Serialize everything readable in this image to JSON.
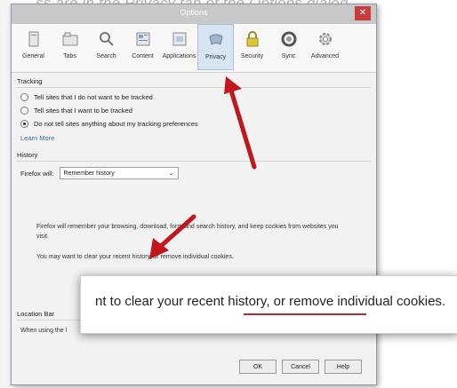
{
  "background": {
    "caption": "ss are in the Privacy tab of the Options dialog"
  },
  "dialog": {
    "title": "Options",
    "close_label": "✕",
    "toolbar": [
      {
        "label": "General",
        "icon": "general-icon"
      },
      {
        "label": "Tabs",
        "icon": "tabs-icon"
      },
      {
        "label": "Search",
        "icon": "search-icon"
      },
      {
        "label": "Content",
        "icon": "content-icon"
      },
      {
        "label": "Applications",
        "icon": "applications-icon"
      },
      {
        "label": "Privacy",
        "icon": "privacy-icon",
        "active": true
      },
      {
        "label": "Security",
        "icon": "lock-icon"
      },
      {
        "label": "Sync",
        "icon": "sync-icon"
      },
      {
        "label": "Advanced",
        "icon": "gear-icon"
      }
    ],
    "tracking": {
      "title": "Tracking",
      "options": [
        "Tell sites that I do not want to be tracked",
        "Tell sites that I want to be tracked",
        "Do not tell sites anything about my tracking preferences"
      ],
      "selected_index": 2,
      "learn_more": "Learn More"
    },
    "history": {
      "title": "History",
      "firefox_will_label": "Firefox will:",
      "select_value": "Remember history",
      "para1": "Firefox will remember your browsing, download, form and search history, and keep cookies from websites you visit.",
      "para2": "You may want to clear your recent history, or remove individual cookies."
    },
    "location_bar": {
      "title": "Location Bar",
      "when_using": "When using the l"
    },
    "buttons": {
      "ok": "OK",
      "cancel": "Cancel",
      "help": "Help"
    }
  },
  "callout": {
    "text_prefix": "nt to clear your ",
    "link_text": "recent history,",
    "text_suffix": " or remove individual cookies."
  },
  "colors": {
    "arrow": "#c0161c",
    "active_tab": "#d7e5f3",
    "link": "#3a6ea5",
    "close": "#cc3b3b"
  }
}
